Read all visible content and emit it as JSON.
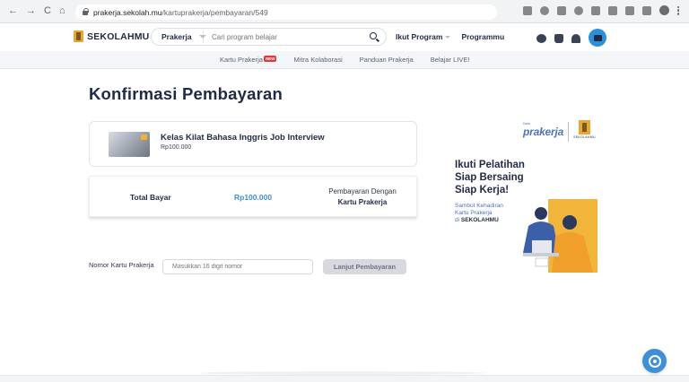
{
  "browser": {
    "url_host": "prakerja.sekolah.mu",
    "url_path": "/kartuprakerja/pembayaran/549",
    "back": "←",
    "forward": "→",
    "reload": "C",
    "home": "⌂"
  },
  "header": {
    "logo_text": "SEKOLAHMU",
    "search_category": "Prakerja",
    "search_placeholder": "Cari program belajar",
    "nav": [
      "Ikut Program",
      "Programmu"
    ]
  },
  "sub_nav": {
    "items": [
      "Kartu Prakerja",
      "Mitra Kolaborasi",
      "Panduan Prakerja",
      "Belajar LIVE!"
    ],
    "new_badge": "NEW"
  },
  "main": {
    "title": "Konfirmasi Pembayaran",
    "course": {
      "name": "Kelas Kilat Bahasa Inggris Job Interview",
      "price": "Rp100.000"
    },
    "summary": {
      "total_label": "Total Bayar",
      "total_amount": "Rp100.000",
      "payment_method_label": "Pembayaran Dengan",
      "payment_method_value": "Kartu Prakerja"
    },
    "card_form": {
      "label": "Nomor Kartu Prakerja",
      "placeholder": "Masukkan 16 digit nomor",
      "button": "Lanjut Pembayaran"
    }
  },
  "promo": {
    "logo_small": "Kartu",
    "logo_word": "prakerja",
    "partner_logo": "SEKOLAHMU",
    "headline": [
      "Ikuti Pelatihan",
      "Siap Bersaing",
      "Siap Kerja!"
    ],
    "sub_lines": [
      "Sambut Kehadiran",
      "Kartu Prakerja",
      "di "
    ],
    "sub_brand": "SEKOLAHMU"
  },
  "colors": {
    "primary_text": "#1f2a44",
    "accent_blue": "#3f8fd6",
    "brand_yellow": "#e8a735",
    "new_badge": "#e03a3a"
  }
}
